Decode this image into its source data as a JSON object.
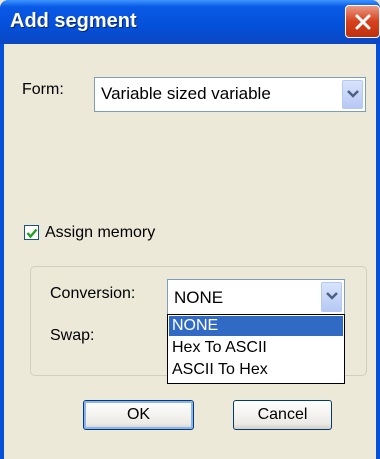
{
  "window": {
    "title": "Add segment"
  },
  "form": {
    "label": "Form:",
    "selected": "Variable sized variable"
  },
  "assign_memory": {
    "label": "Assign memory",
    "checked": true
  },
  "conversion": {
    "label": "Conversion:",
    "selected": "NONE",
    "options": [
      "NONE",
      "Hex To ASCII",
      "ASCII To Hex"
    ],
    "highlighted_index": 0
  },
  "swap": {
    "label": "Swap:"
  },
  "buttons": {
    "ok": "OK",
    "cancel": "Cancel"
  },
  "colors": {
    "titlebar": "#0450d9",
    "dialog_bg": "#ece9d8",
    "selection": "#316ac5",
    "close": "#d6411c"
  },
  "icons": {
    "close": "close-icon",
    "dropdown": "chevron-down-icon",
    "check": "check-icon"
  }
}
